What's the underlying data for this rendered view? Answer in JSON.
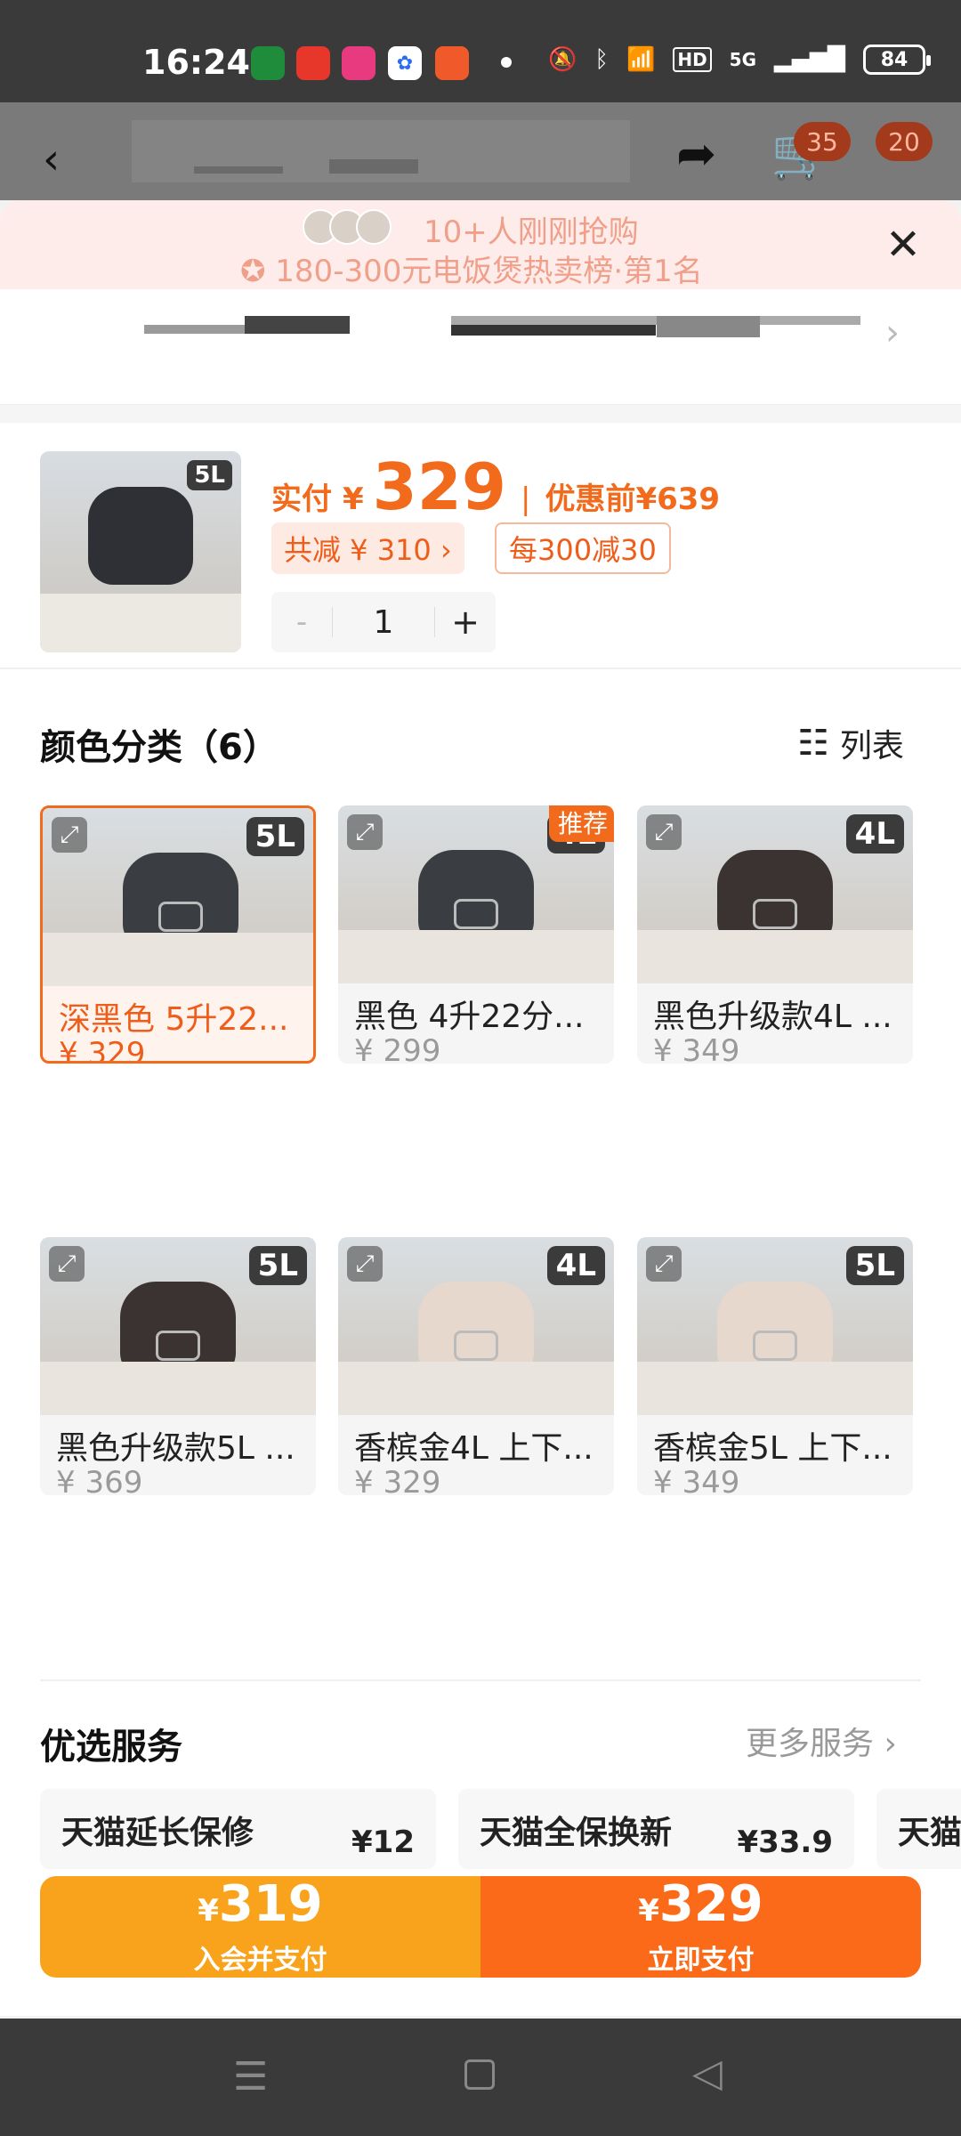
{
  "status_bar": {
    "time": "16:24",
    "network": "5G",
    "hd": "HD",
    "battery": "84",
    "icons": [
      "mute-icon",
      "bluetooth-icon",
      "wifi-icon",
      "signal-icon"
    ]
  },
  "header": {
    "cart_badge": "35",
    "more_badge": "20"
  },
  "promo": {
    "line1": "10+人刚刚抢购",
    "line2": "180-300元电饭煲热卖榜·第1名"
  },
  "product": {
    "thumb_volume": "5L",
    "paid_label": "实付",
    "currency": "¥",
    "paid_price": "329",
    "separator": "|",
    "original_label": "优惠前",
    "original_price": "¥639",
    "discount_chip": "共减 ¥ 310 ›",
    "coupon_chip": "每300减30",
    "quantity": "1",
    "minus": "-",
    "plus": "+"
  },
  "color_section": {
    "title": "颜色分类（6）",
    "view_toggle": "列表",
    "options": [
      {
        "name": "深黑色 5升22...",
        "price": "¥ 329",
        "volume": "5L",
        "selected": true,
        "recommended": false,
        "body_color": "#3a3d42"
      },
      {
        "name": "黑色 4升22分...",
        "price": "¥ 299",
        "volume": "4L",
        "selected": false,
        "recommended": true,
        "body_color": "#3a3d42"
      },
      {
        "name": "黑色升级款4L ...",
        "price": "¥ 349",
        "volume": "4L",
        "selected": false,
        "recommended": false,
        "body_color": "#3a3332"
      },
      {
        "name": "黑色升级款5L ...",
        "price": "¥ 369",
        "volume": "5L",
        "selected": false,
        "recommended": false,
        "body_color": "#3a3332"
      },
      {
        "name": "香槟金4L 上下...",
        "price": "¥ 329",
        "volume": "4L",
        "selected": false,
        "recommended": false,
        "body_color": "#e6d8cc"
      },
      {
        "name": "香槟金5L 上下...",
        "price": "¥ 349",
        "volume": "5L",
        "selected": false,
        "recommended": false,
        "body_color": "#e6d8cc"
      }
    ],
    "recommend_tag": "推荐"
  },
  "services": {
    "title": "优选服务",
    "more": "更多服务 ›",
    "items": [
      {
        "name": "天猫延长保修",
        "price": "¥12"
      },
      {
        "name": "天猫全保换新",
        "price": "¥33.9"
      },
      {
        "name": "天猫"
      }
    ]
  },
  "pay_bar": {
    "member": {
      "currency": "¥",
      "amount": "319",
      "caption": "入会并支付",
      "color": "#f9a21b"
    },
    "pay": {
      "currency": "¥",
      "amount": "329",
      "caption": "立即支付",
      "color": "#fb6a18"
    }
  },
  "accent": "#f26a1b"
}
